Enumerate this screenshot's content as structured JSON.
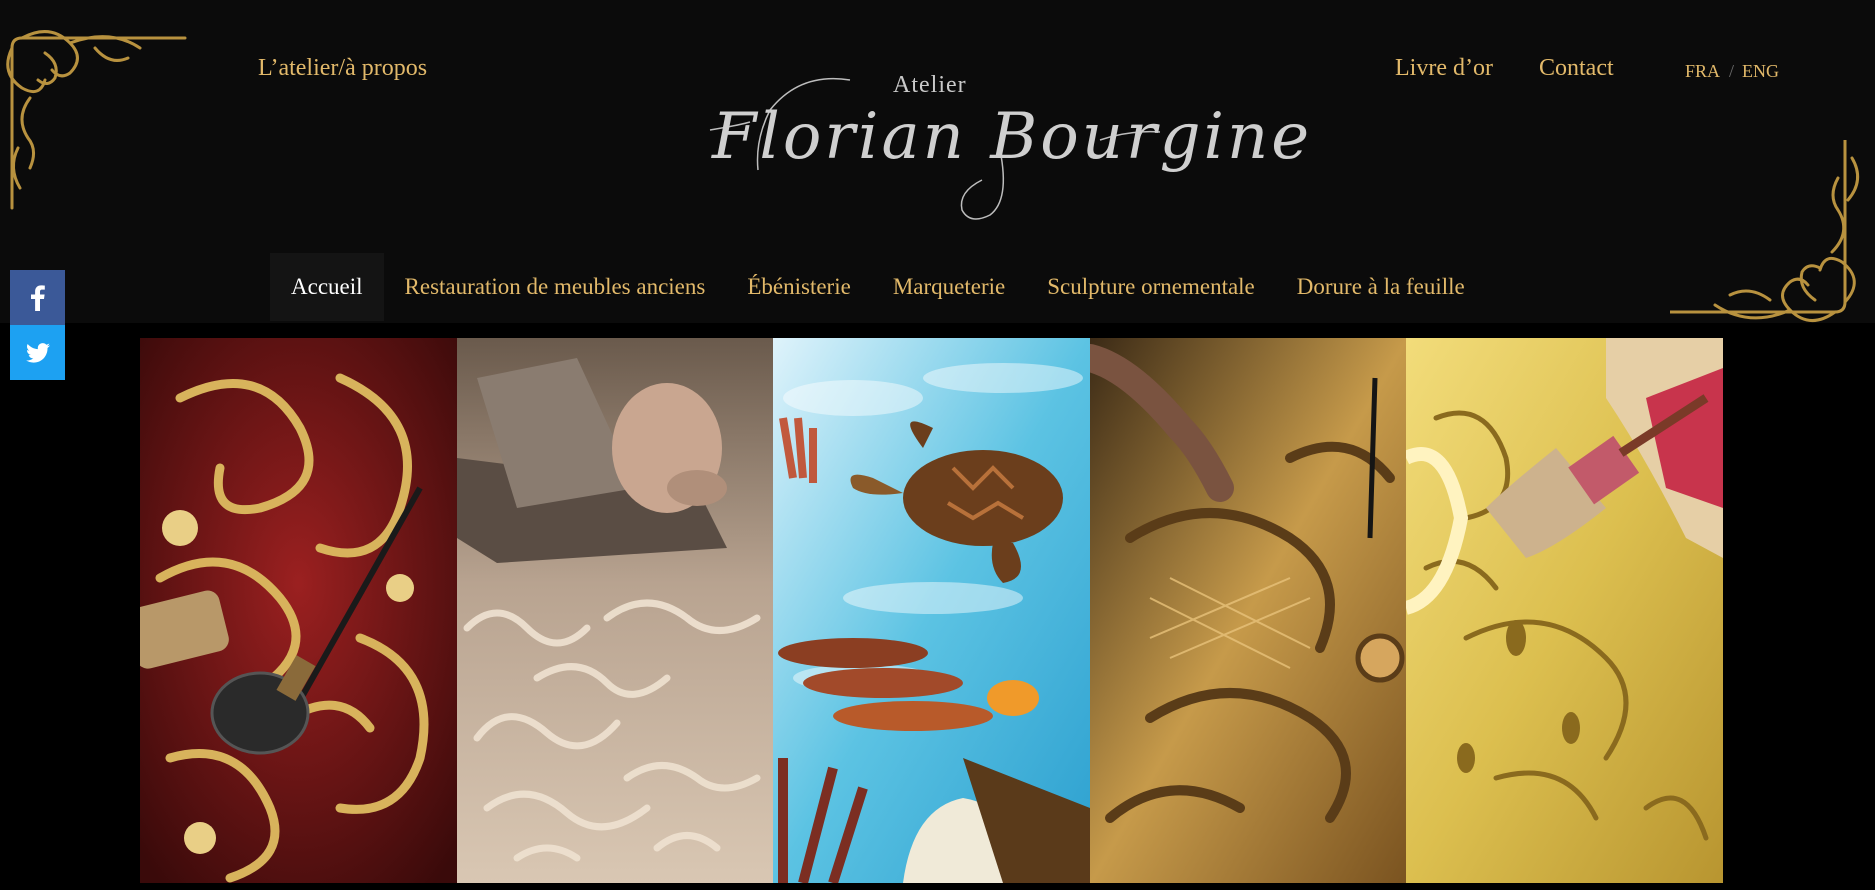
{
  "header": {
    "left_link": "L’atelier/à propos",
    "right_links": [
      "Livre d’or",
      "Contact"
    ],
    "languages": [
      "FRA",
      "ENG"
    ],
    "language_separator": "/",
    "logo": {
      "small": "Atelier",
      "name": "Florian Bourgine"
    }
  },
  "nav": {
    "items": [
      {
        "label": "Accueil",
        "active": true
      },
      {
        "label": "Restauration de meubles anciens"
      },
      {
        "label": "Ébénisterie"
      },
      {
        "label": "Marqueterie"
      },
      {
        "label": "Sculpture ornementale"
      },
      {
        "label": "Dorure à la feuille"
      }
    ]
  },
  "social": {
    "icons": [
      "facebook-icon",
      "twitter-icon"
    ]
  },
  "gallery": {
    "panels": [
      "boulle-marquetry",
      "wood-plane-shavings",
      "sea-turtle-marquetry",
      "wood-carving",
      "gilding-brush"
    ]
  },
  "colors": {
    "header_bg": "#0b0b0b",
    "link_gold": "#e2b96a",
    "facebook": "#3b5998",
    "twitter": "#1da1f2"
  }
}
